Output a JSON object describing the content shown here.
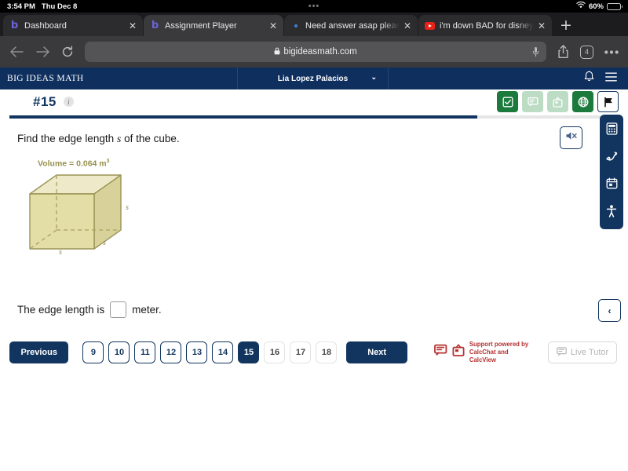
{
  "status_bar": {
    "time": "3:54 PM",
    "date": "Thu Dec 8",
    "center_dots": "•••",
    "battery_percent": "60%",
    "wifi_icon": "wifi-icon",
    "battery_icon": "battery-icon"
  },
  "browser": {
    "tabs": [
      {
        "title": "Dashboard",
        "favicon": "bigideasmath-favicon",
        "close": "✕",
        "active": false
      },
      {
        "title": "Assignment Player",
        "favicon": "bigideasmath-favicon",
        "close": "✕",
        "active": true
      },
      {
        "title": "Need answer asap pleas",
        "favicon": "blue-dot-favicon",
        "close": "✕",
        "active": false
      },
      {
        "title": "i'm down BAD for disney",
        "favicon": "youtube-favicon",
        "close": "✕",
        "active": false
      }
    ],
    "new_tab_label": "+",
    "back_icon": "back-arrow-icon",
    "forward_icon": "forward-arrow-icon",
    "reload_icon": "reload-icon",
    "url": "bigideasmath.com",
    "lock_icon": "lock-icon",
    "mic_icon": "microphone-icon",
    "share_icon": "share-icon",
    "tab_count": "4",
    "more_icon": "more-options-icon"
  },
  "app_header": {
    "brand": "BIG IDEAS MATH",
    "user_name": "Lia Lopez Palacios",
    "user_caret": "⌄",
    "bell_icon": "notification-bell-icon",
    "menu_icon": "hamburger-menu-icon"
  },
  "question_header": {
    "number": "#15",
    "info_label": "i",
    "tools": [
      {
        "name": "check-answer-icon",
        "state": "enabled"
      },
      {
        "name": "chat-icon",
        "state": "disabled"
      },
      {
        "name": "video-icon",
        "state": "disabled"
      },
      {
        "name": "language-globe-icon",
        "state": "enabled"
      },
      {
        "name": "flag-icon",
        "state": "outline"
      }
    ],
    "progress_percent": 78,
    "accent_color": "#12355f",
    "tool_green": "#1d7a3d"
  },
  "question": {
    "prompt_before": "Find the edge length",
    "variable": "s",
    "prompt_after": "of the cube.",
    "mute_icon": "speaker-muted-icon",
    "figure": {
      "volume_label": "Volume = 0.064 m",
      "volume_exponent": "3",
      "edge_labels": [
        "s",
        "s",
        "s"
      ],
      "face_top_color": "#eeeac9",
      "face_front_color": "#e3dda6",
      "face_side_color": "#d8d29a",
      "edge_color": "#9a9455",
      "label_color": "#97914e"
    },
    "answer_before": "The edge length is",
    "answer_value": "",
    "answer_after": "meter.",
    "collapse_label": "‹"
  },
  "side_rail": {
    "items": [
      {
        "name": "calculator-icon"
      },
      {
        "name": "scribble-pen-icon"
      },
      {
        "name": "notes-calendar-icon"
      },
      {
        "name": "accessibility-icon"
      }
    ]
  },
  "footer": {
    "previous_label": "Previous",
    "next_label": "Next",
    "pages": [
      {
        "label": "9",
        "state": "available"
      },
      {
        "label": "10",
        "state": "available"
      },
      {
        "label": "11",
        "state": "available"
      },
      {
        "label": "12",
        "state": "available"
      },
      {
        "label": "13",
        "state": "available"
      },
      {
        "label": "14",
        "state": "available"
      },
      {
        "label": "15",
        "state": "active"
      },
      {
        "label": "16",
        "state": "future"
      },
      {
        "label": "17",
        "state": "future"
      },
      {
        "label": "18",
        "state": "future"
      }
    ],
    "support_line1": "Support powered by",
    "support_line2": "CalcChat and CalcView",
    "support_color": "#b73131",
    "support_chat_icon": "calcchat-icon",
    "support_video_icon": "calcview-icon",
    "live_tutor_label": "Live Tutor",
    "live_tutor_icon": "live-tutor-screen-icon"
  }
}
